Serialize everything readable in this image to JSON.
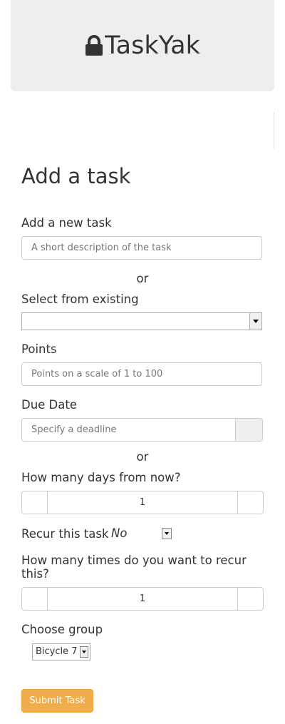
{
  "header": {
    "brand": "TaskYak",
    "brand_icon": "lock-icon"
  },
  "form": {
    "title": "Add a task",
    "new_task": {
      "label": "Add a new task",
      "placeholder": "A short description of the task",
      "value": ""
    },
    "or_1": "or",
    "existing": {
      "label": "Select from existing",
      "value": ""
    },
    "points": {
      "label": "Points",
      "placeholder": "Points on a scale of 1 to 100",
      "value": ""
    },
    "due_date": {
      "label": "Due Date",
      "placeholder": "Specify a deadline",
      "value": ""
    },
    "or_2": "or",
    "days_from_now": {
      "label": "How many days from now?",
      "value": "1"
    },
    "recur": {
      "label": "Recur this task",
      "value": "No"
    },
    "recur_times": {
      "label": "How many times do you want to recur this?",
      "value": "1"
    },
    "group": {
      "label": "Choose group",
      "value": "Bicycle 7"
    },
    "submit_label": "Submit Task"
  },
  "colors": {
    "accent": "#f0ad4e",
    "jumbotron": "#eeeeee"
  }
}
